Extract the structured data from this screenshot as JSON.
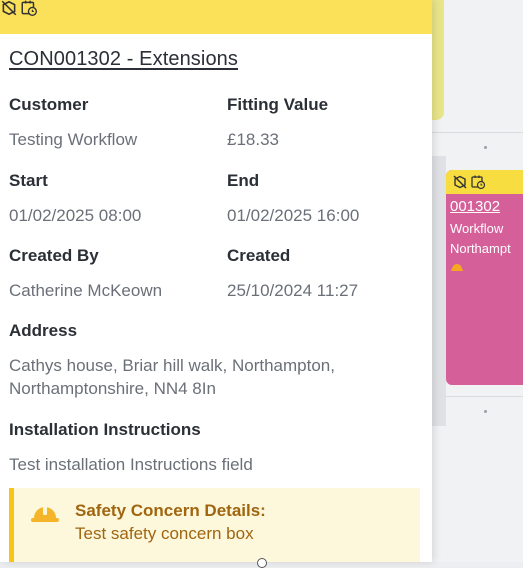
{
  "popover": {
    "title": "CON001302 - Extensions",
    "fields": {
      "customer_label": "Customer",
      "customer_value": "Testing Workflow",
      "fitting_value_label": "Fitting Value",
      "fitting_value_value": "£18.33",
      "start_label": "Start",
      "start_value": "01/02/2025 08:00",
      "end_label": "End",
      "end_value": "01/02/2025 16:00",
      "created_by_label": "Created By",
      "created_by_value": "Catherine McKeown",
      "created_label": "Created",
      "created_value": "25/10/2024 11:27",
      "address_label": "Address",
      "address_line1": "Cathys house, Briar hill walk, Northampton,",
      "address_line2": "Northamptonshire, NN4 8In",
      "installation_label": "Installation Instructions",
      "installation_value": "Test installation Instructions field"
    },
    "safety": {
      "title": "Safety Concern Details:",
      "text": "Test safety concern box",
      "icon": "hard-hat-icon"
    },
    "header_icons": [
      "no-box-icon",
      "calendar-clock-icon"
    ]
  },
  "event_card": {
    "id": "001302",
    "line1": "Workflow",
    "line2": "Northampt",
    "icons": [
      "no-box-icon",
      "calendar-clock-icon",
      "hard-hat-icon"
    ]
  },
  "colors": {
    "header_yellow": "#fbe05a",
    "event_pink": "#d45f99",
    "safety_bg": "#fdf8dc",
    "safety_border": "#f5c518",
    "safety_text": "#a0650f"
  }
}
